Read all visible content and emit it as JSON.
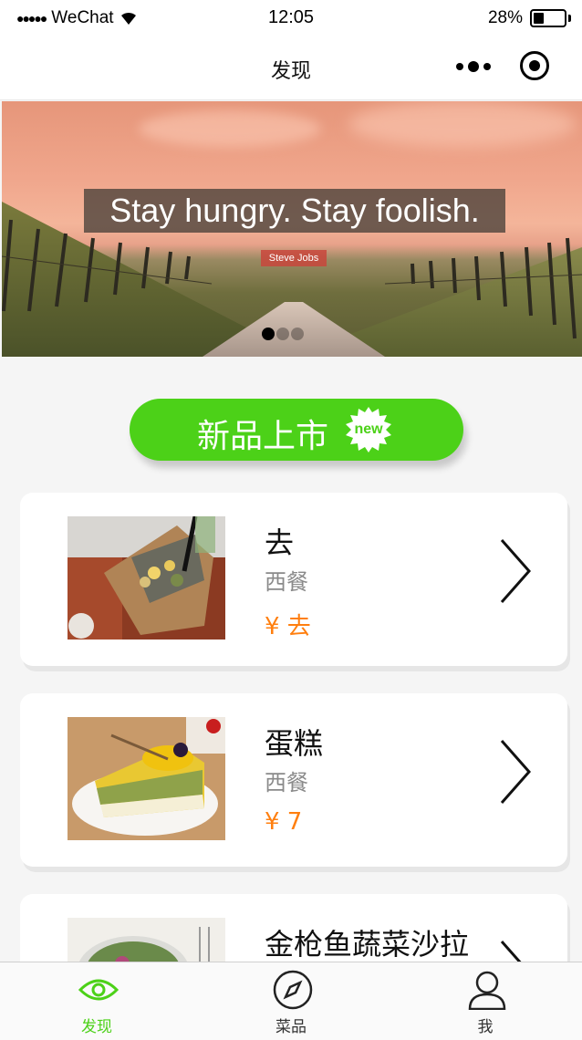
{
  "status_bar": {
    "signal_dots": "●●●●●",
    "carrier": "WeChat",
    "time": "12:05",
    "battery": "28%",
    "battery_level": 0.28
  },
  "nav": {
    "title": "发现"
  },
  "banner": {
    "quote": "Stay hungry. Stay foolish.",
    "author": "Steve Jobs",
    "page_count": 3,
    "active_page": 1
  },
  "new_products": {
    "label": "新品上市",
    "badge": "new"
  },
  "items": [
    {
      "name": "去",
      "category": "西餐",
      "price": "¥ 去"
    },
    {
      "name": "蛋糕",
      "category": "西餐",
      "price": "¥ 7"
    },
    {
      "name": "金枪鱼蔬菜沙拉",
      "category": "",
      "price": ""
    }
  ],
  "tabbar": {
    "tabs": [
      {
        "label": "发现",
        "icon": "eye-icon",
        "active": true
      },
      {
        "label": "菜品",
        "icon": "compass-icon",
        "active": false
      },
      {
        "label": "我",
        "icon": "user-icon",
        "active": false
      }
    ]
  },
  "colors": {
    "accent": "#4cd118",
    "price": "#ff7f0f"
  }
}
